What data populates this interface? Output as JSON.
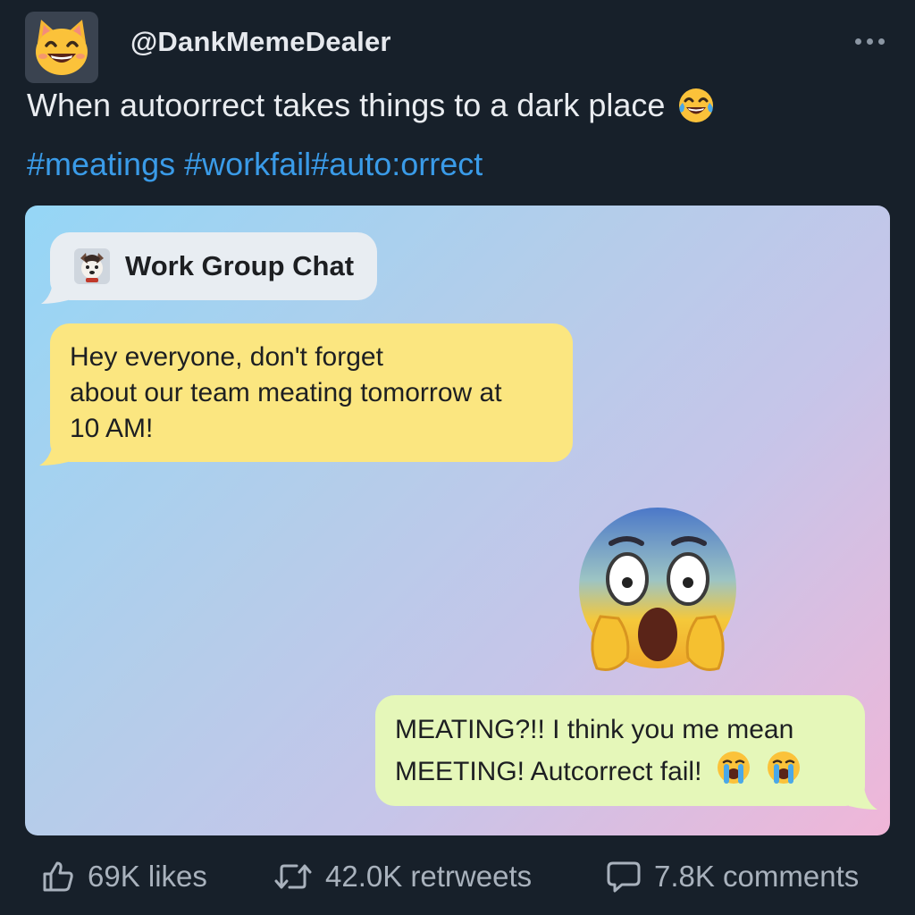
{
  "post": {
    "username": "@DankMemeDealer",
    "avatar_icon": "grinning-cat-icon",
    "text": "When autoorrect takes things to a dark place",
    "text_emoji": "face-with-tears-of-joy-icon",
    "hashtags": "#meatings #workfail#auto:orrect"
  },
  "chat": {
    "title": "Work Group Chat",
    "title_icon": "dog-avatar-icon",
    "message_1": {
      "lines": [
        "Hey everyone, don't forget",
        "about our team meating tomorrow at",
        "10 AM!"
      ]
    },
    "reaction_emoji": "face-screaming-in-fear-icon",
    "message_2": {
      "lines": [
        "MEATING?!! I think you me mean",
        "MEETING! Autcorrect fail!"
      ],
      "emojis": [
        "loudly-crying-face-icon",
        "loudly-crying-face-icon"
      ]
    }
  },
  "actions": {
    "likes": "69K likes",
    "retweets": "42.0K retrweets",
    "comments": "7.8K comments"
  },
  "colors": {
    "background": "#17202a",
    "hashtag": "#3a9be8",
    "yellow_bubble": "#fbe680",
    "green_bubble": "#e5f7b9"
  }
}
